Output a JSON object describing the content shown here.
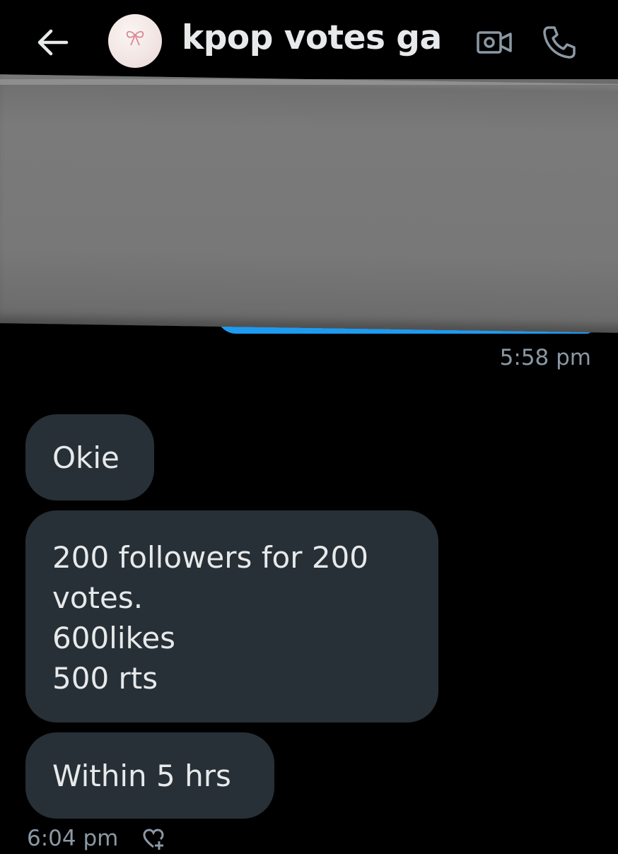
{
  "header": {
    "title": "kpop votes ga"
  },
  "conversation": {
    "sent": {
      "timestamp": "5:58 pm"
    },
    "received": [
      {
        "text": "Okie"
      },
      {
        "lines": [
          "200 followers for 200",
          "votes.",
          "600likes",
          "500 rts"
        ]
      },
      {
        "text": "Within 5 hrs"
      }
    ],
    "received_timestamp": "6:04 pm"
  },
  "icons": {
    "back": "arrow-left-icon",
    "video": "video-camera-icon",
    "call": "phone-icon",
    "react": "heart-plus-icon"
  },
  "colors": {
    "background": "#000000",
    "received_bubble": "#273036",
    "sent_bubble": "#1d9bf0",
    "muted_text": "#8b98a5",
    "redaction": "#777777"
  }
}
